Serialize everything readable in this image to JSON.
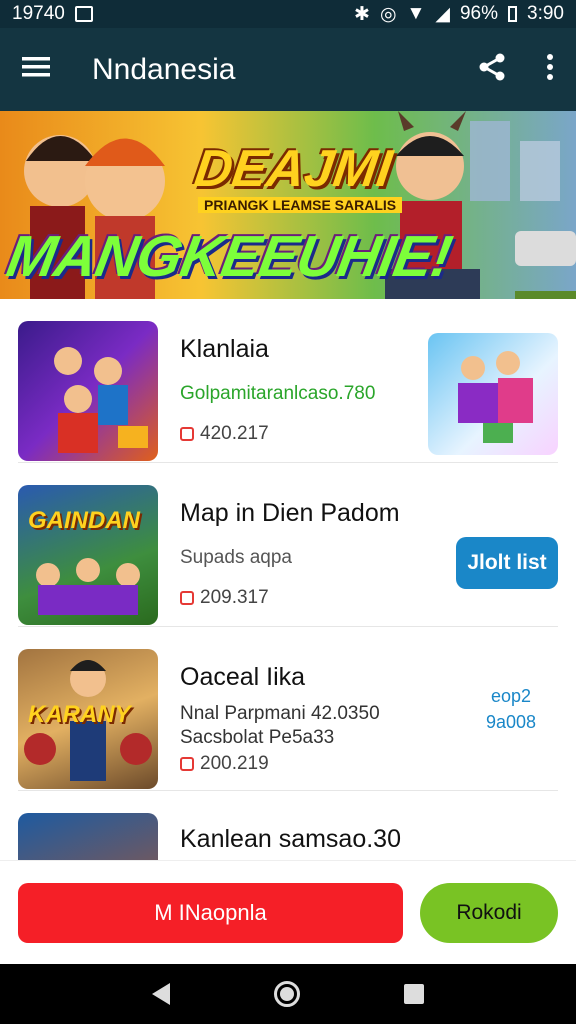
{
  "status_bar": {
    "time_left": "19740",
    "time_right": "3:90",
    "battery": "96%"
  },
  "app_bar": {
    "title": "Nndanesia"
  },
  "banner": {
    "title_top": "DEAJMI",
    "subtitle": "PRIANGK LEAMSE SARALIS",
    "title_bottom": "MANGKEEUHIE!"
  },
  "games": [
    {
      "title": "Klanlaia",
      "subtitle": "Golpamitaranlcaso.780",
      "count": "420.217",
      "thumb_text": ""
    },
    {
      "title": "Map in Dien Padom",
      "subtitle": "Supads aqpa",
      "count": "209.317",
      "button": "Jlolt list",
      "thumb_text": "GAINDAN"
    },
    {
      "title": "Oaceal Iika",
      "subtitle": "Nnal Parpmani 42.0350",
      "subtitle2": "Sacsbolat Pe5a33",
      "count": "200.219",
      "right_code_1": "eop2",
      "right_code_2": "9a008",
      "thumb_text": "KARANY"
    },
    {
      "title": "Kanlean samsao.30"
    }
  ],
  "actions": {
    "primary": "M INaopnla",
    "secondary": "Rokodi"
  },
  "colors": {
    "app_bar": "#143541",
    "primary_button": "#f51f27",
    "secondary_button": "#79c324",
    "accent_blue": "#1a87c8"
  }
}
